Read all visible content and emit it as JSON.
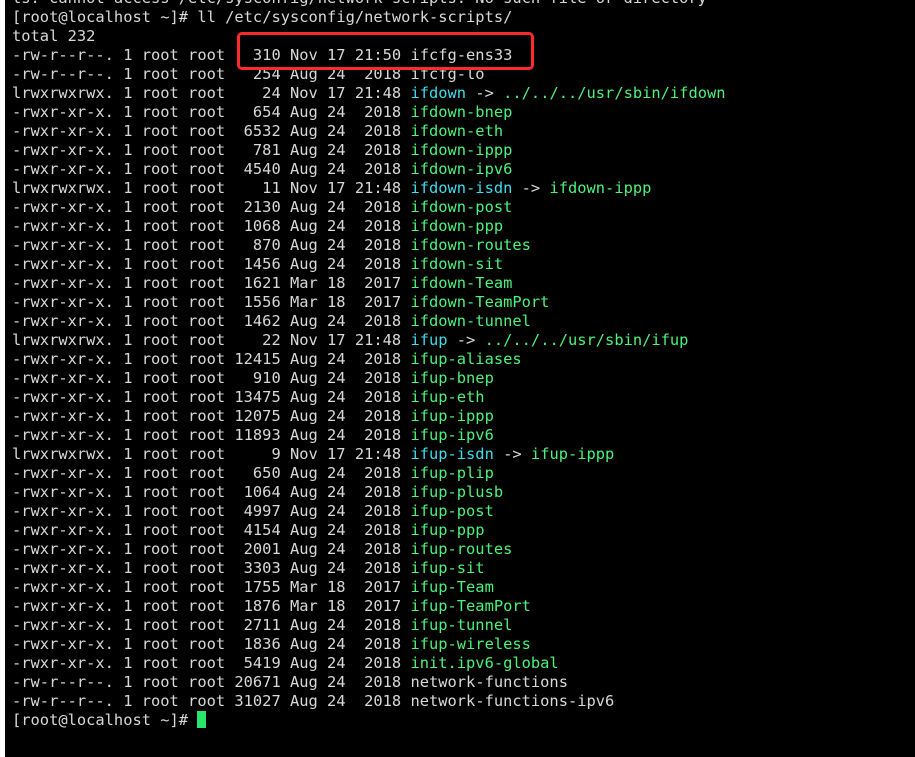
{
  "terminal": {
    "top_line": "ls: cannot access /etc/sysconfig/network-scripts: No such file or directory",
    "command_prompt": "[root@localhost ~]# ",
    "command": "ll /etc/sysconfig/network-scripts/",
    "total_line": "total 232",
    "final_prompt": "[root@localhost ~]# ",
    "colors": {
      "background": "#000000",
      "text": "#d8d8d8",
      "executable": "#4cf27a",
      "symlink": "#3fdcec",
      "highlight_box": "#ff2a2a",
      "cursor": "#27e66b"
    },
    "entries": [
      {
        "meta": "-rw-r--r--. 1 root root   310 Nov 17 21:50 ",
        "name": "ifcfg-ens33",
        "type": "file",
        "target": ""
      },
      {
        "meta": "-rw-r--r--. 1 root root   254 Aug 24  2018 ",
        "name": "ifcfg-lo",
        "type": "file",
        "target": ""
      },
      {
        "meta": "lrwxrwxrwx. 1 root root    24 Nov 17 21:48 ",
        "name": "ifdown",
        "type": "link",
        "target": "../../../usr/sbin/ifdown"
      },
      {
        "meta": "-rwxr-xr-x. 1 root root   654 Aug 24  2018 ",
        "name": "ifdown-bnep",
        "type": "exec",
        "target": ""
      },
      {
        "meta": "-rwxr-xr-x. 1 root root  6532 Aug 24  2018 ",
        "name": "ifdown-eth",
        "type": "exec",
        "target": ""
      },
      {
        "meta": "-rwxr-xr-x. 1 root root   781 Aug 24  2018 ",
        "name": "ifdown-ippp",
        "type": "exec",
        "target": ""
      },
      {
        "meta": "-rwxr-xr-x. 1 root root  4540 Aug 24  2018 ",
        "name": "ifdown-ipv6",
        "type": "exec",
        "target": ""
      },
      {
        "meta": "lrwxrwxrwx. 1 root root    11 Nov 17 21:48 ",
        "name": "ifdown-isdn",
        "type": "link",
        "target": "ifdown-ippp"
      },
      {
        "meta": "-rwxr-xr-x. 1 root root  2130 Aug 24  2018 ",
        "name": "ifdown-post",
        "type": "exec",
        "target": ""
      },
      {
        "meta": "-rwxr-xr-x. 1 root root  1068 Aug 24  2018 ",
        "name": "ifdown-ppp",
        "type": "exec",
        "target": ""
      },
      {
        "meta": "-rwxr-xr-x. 1 root root   870 Aug 24  2018 ",
        "name": "ifdown-routes",
        "type": "exec",
        "target": ""
      },
      {
        "meta": "-rwxr-xr-x. 1 root root  1456 Aug 24  2018 ",
        "name": "ifdown-sit",
        "type": "exec",
        "target": ""
      },
      {
        "meta": "-rwxr-xr-x. 1 root root  1621 Mar 18  2017 ",
        "name": "ifdown-Team",
        "type": "exec",
        "target": ""
      },
      {
        "meta": "-rwxr-xr-x. 1 root root  1556 Mar 18  2017 ",
        "name": "ifdown-TeamPort",
        "type": "exec",
        "target": ""
      },
      {
        "meta": "-rwxr-xr-x. 1 root root  1462 Aug 24  2018 ",
        "name": "ifdown-tunnel",
        "type": "exec",
        "target": ""
      },
      {
        "meta": "lrwxrwxrwx. 1 root root    22 Nov 17 21:48 ",
        "name": "ifup",
        "type": "link",
        "target": "../../../usr/sbin/ifup"
      },
      {
        "meta": "-rwxr-xr-x. 1 root root 12415 Aug 24  2018 ",
        "name": "ifup-aliases",
        "type": "exec",
        "target": ""
      },
      {
        "meta": "-rwxr-xr-x. 1 root root   910 Aug 24  2018 ",
        "name": "ifup-bnep",
        "type": "exec",
        "target": ""
      },
      {
        "meta": "-rwxr-xr-x. 1 root root 13475 Aug 24  2018 ",
        "name": "ifup-eth",
        "type": "exec",
        "target": ""
      },
      {
        "meta": "-rwxr-xr-x. 1 root root 12075 Aug 24  2018 ",
        "name": "ifup-ippp",
        "type": "exec",
        "target": ""
      },
      {
        "meta": "-rwxr-xr-x. 1 root root 11893 Aug 24  2018 ",
        "name": "ifup-ipv6",
        "type": "exec",
        "target": ""
      },
      {
        "meta": "lrwxrwxrwx. 1 root root     9 Nov 17 21:48 ",
        "name": "ifup-isdn",
        "type": "link",
        "target": "ifup-ippp"
      },
      {
        "meta": "-rwxr-xr-x. 1 root root   650 Aug 24  2018 ",
        "name": "ifup-plip",
        "type": "exec",
        "target": ""
      },
      {
        "meta": "-rwxr-xr-x. 1 root root  1064 Aug 24  2018 ",
        "name": "ifup-plusb",
        "type": "exec",
        "target": ""
      },
      {
        "meta": "-rwxr-xr-x. 1 root root  4997 Aug 24  2018 ",
        "name": "ifup-post",
        "type": "exec",
        "target": ""
      },
      {
        "meta": "-rwxr-xr-x. 1 root root  4154 Aug 24  2018 ",
        "name": "ifup-ppp",
        "type": "exec",
        "target": ""
      },
      {
        "meta": "-rwxr-xr-x. 1 root root  2001 Aug 24  2018 ",
        "name": "ifup-routes",
        "type": "exec",
        "target": ""
      },
      {
        "meta": "-rwxr-xr-x. 1 root root  3303 Aug 24  2018 ",
        "name": "ifup-sit",
        "type": "exec",
        "target": ""
      },
      {
        "meta": "-rwxr-xr-x. 1 root root  1755 Mar 18  2017 ",
        "name": "ifup-Team",
        "type": "exec",
        "target": ""
      },
      {
        "meta": "-rwxr-xr-x. 1 root root  1876 Mar 18  2017 ",
        "name": "ifup-TeamPort",
        "type": "exec",
        "target": ""
      },
      {
        "meta": "-rwxr-xr-x. 1 root root  2711 Aug 24  2018 ",
        "name": "ifup-tunnel",
        "type": "exec",
        "target": ""
      },
      {
        "meta": "-rwxr-xr-x. 1 root root  1836 Aug 24  2018 ",
        "name": "ifup-wireless",
        "type": "exec",
        "target": ""
      },
      {
        "meta": "-rwxr-xr-x. 1 root root  5419 Aug 24  2018 ",
        "name": "init.ipv6-global",
        "type": "exec",
        "target": ""
      },
      {
        "meta": "-rw-r--r--. 1 root root 20671 Aug 24  2018 ",
        "name": "network-functions",
        "type": "file",
        "target": ""
      },
      {
        "meta": "-rw-r--r--. 1 root root 31027 Aug 24  2018 ",
        "name": "network-functions-ipv6",
        "type": "file",
        "target": ""
      }
    ]
  }
}
